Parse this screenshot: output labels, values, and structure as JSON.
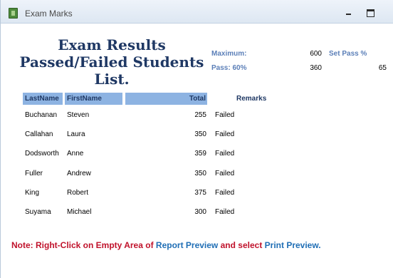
{
  "window": {
    "title": "Exam Marks"
  },
  "report": {
    "heading": "Exam Results Passed/Failed Students List.",
    "maximum_label": "Maximum:",
    "maximum_value": "600",
    "set_pass_label": "Set Pass %",
    "pass_label": "Pass: 60%",
    "pass_value": "360",
    "set_pass_value": "65",
    "columns": {
      "last": "LastName",
      "first": "FirstName",
      "total": "Total",
      "remarks": "Remarks"
    },
    "rows": [
      {
        "last": "Buchanan",
        "first": "Steven",
        "total": "255",
        "remark": "Failed"
      },
      {
        "last": "Callahan",
        "first": "Laura",
        "total": "350",
        "remark": "Failed"
      },
      {
        "last": "Dodsworth",
        "first": "Anne",
        "total": "359",
        "remark": "Failed"
      },
      {
        "last": "Fuller",
        "first": "Andrew",
        "total": "350",
        "remark": "Failed"
      },
      {
        "last": "King",
        "first": "Robert",
        "total": "375",
        "remark": "Failed"
      },
      {
        "last": "Suyama",
        "first": "Michael",
        "total": "300",
        "remark": "Failed"
      }
    ]
  },
  "note": {
    "part1": "Note: Right-Click on Empty Area of ",
    "part2": "Report Preview",
    "part3": " and select ",
    "part4": " Print Preview."
  }
}
